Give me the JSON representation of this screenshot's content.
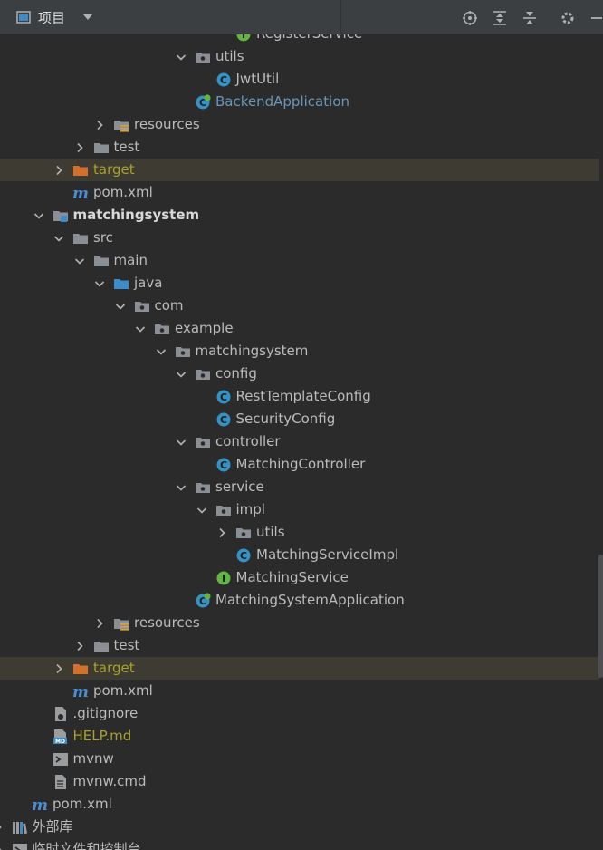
{
  "header": {
    "title": "项目",
    "view_icon": "project-view-icon",
    "caret_icon": "chevron-down-icon",
    "toolbar": [
      {
        "name": "locate-icon"
      },
      {
        "name": "expand-all-icon"
      },
      {
        "name": "collapse-all-icon"
      },
      {
        "name": "gear-icon"
      },
      {
        "name": "minimize-icon"
      }
    ]
  },
  "colors": {
    "background": "#2b2b2b",
    "header": "#3c3f41",
    "excluded_row": "#3d3b32",
    "text": "#bbbbbb",
    "blue_text": "#6897bb",
    "olive_text": "#a8a22a",
    "folder": "#8a8f95",
    "source_folder": "#3d8bc7",
    "excluded_folder": "#d4702c",
    "class_icon": "#3592c4",
    "interface_icon": "#62b543",
    "maven_icon": "#4c8dd0"
  },
  "tree": [
    {
      "label": "RegisterService",
      "icon": "interface",
      "indent": 12,
      "expand": "none",
      "style": "default"
    },
    {
      "label": "utils",
      "icon": "package",
      "indent": 10,
      "expand": "open",
      "style": "default"
    },
    {
      "label": "JwtUtil",
      "icon": "class",
      "indent": 11,
      "expand": "none",
      "style": "default"
    },
    {
      "label": "BackendApplication",
      "icon": "spring-boot-class",
      "indent": 10,
      "expand": "none",
      "style": "blue"
    },
    {
      "label": "resources",
      "icon": "resources-folder",
      "indent": 6,
      "expand": "closed",
      "style": "default"
    },
    {
      "label": "test",
      "icon": "folder",
      "indent": 5,
      "expand": "closed",
      "style": "default"
    },
    {
      "label": "target",
      "icon": "excluded-folder",
      "indent": 4,
      "expand": "closed",
      "style": "olive",
      "excluded": true
    },
    {
      "label": "pom.xml",
      "icon": "maven",
      "indent": 4,
      "expand": "none",
      "style": "default"
    },
    {
      "label": "matchingsystem",
      "icon": "module",
      "indent": 3,
      "expand": "open",
      "style": "bold"
    },
    {
      "label": "src",
      "icon": "folder",
      "indent": 4,
      "expand": "open",
      "style": "default"
    },
    {
      "label": "main",
      "icon": "folder",
      "indent": 5,
      "expand": "open",
      "style": "default"
    },
    {
      "label": "java",
      "icon": "source-folder",
      "indent": 6,
      "expand": "open",
      "style": "default"
    },
    {
      "label": "com",
      "icon": "package",
      "indent": 7,
      "expand": "open",
      "style": "default"
    },
    {
      "label": "example",
      "icon": "package",
      "indent": 8,
      "expand": "open",
      "style": "default"
    },
    {
      "label": "matchingsystem",
      "icon": "package",
      "indent": 9,
      "expand": "open",
      "style": "default"
    },
    {
      "label": "config",
      "icon": "package",
      "indent": 10,
      "expand": "open",
      "style": "default"
    },
    {
      "label": "RestTemplateConfig",
      "icon": "class",
      "indent": 11,
      "expand": "none",
      "style": "default"
    },
    {
      "label": "SecurityConfig",
      "icon": "class",
      "indent": 11,
      "expand": "none",
      "style": "default"
    },
    {
      "label": "controller",
      "icon": "package",
      "indent": 10,
      "expand": "open",
      "style": "default"
    },
    {
      "label": "MatchingController",
      "icon": "class",
      "indent": 11,
      "expand": "none",
      "style": "default"
    },
    {
      "label": "service",
      "icon": "package",
      "indent": 10,
      "expand": "open",
      "style": "default"
    },
    {
      "label": "impl",
      "icon": "package",
      "indent": 11,
      "expand": "open",
      "style": "default"
    },
    {
      "label": "utils",
      "icon": "package",
      "indent": 12,
      "expand": "closed",
      "style": "default"
    },
    {
      "label": "MatchingServiceImpl",
      "icon": "class",
      "indent": 12,
      "expand": "none",
      "style": "default"
    },
    {
      "label": "MatchingService",
      "icon": "interface",
      "indent": 11,
      "expand": "none",
      "style": "default"
    },
    {
      "label": "MatchingSystemApplication",
      "icon": "spring-boot-class",
      "indent": 10,
      "expand": "none",
      "style": "default"
    },
    {
      "label": "resources",
      "icon": "resources-folder",
      "indent": 6,
      "expand": "closed",
      "style": "default"
    },
    {
      "label": "test",
      "icon": "folder",
      "indent": 5,
      "expand": "closed",
      "style": "default"
    },
    {
      "label": "target",
      "icon": "excluded-folder",
      "indent": 4,
      "expand": "closed",
      "style": "olive",
      "excluded": true
    },
    {
      "label": "pom.xml",
      "icon": "maven",
      "indent": 4,
      "expand": "none",
      "style": "default"
    },
    {
      "label": ".gitignore",
      "icon": "ignore-file",
      "indent": 3,
      "expand": "none",
      "style": "default"
    },
    {
      "label": "HELP.md",
      "icon": "markdown-file",
      "indent": 3,
      "expand": "none",
      "style": "olive"
    },
    {
      "label": "mvnw",
      "icon": "shell-file",
      "indent": 3,
      "expand": "none",
      "style": "default"
    },
    {
      "label": "mvnw.cmd",
      "icon": "text-file",
      "indent": 3,
      "expand": "none",
      "style": "default"
    },
    {
      "label": "pom.xml",
      "icon": "maven",
      "indent": 2,
      "expand": "none",
      "style": "default"
    },
    {
      "label": "外部库",
      "icon": "library",
      "indent": 1,
      "expand": "closed",
      "style": "default"
    },
    {
      "label": "临时文件和控制台",
      "icon": "scratches",
      "indent": 1,
      "expand": "closed",
      "style": "default"
    }
  ]
}
